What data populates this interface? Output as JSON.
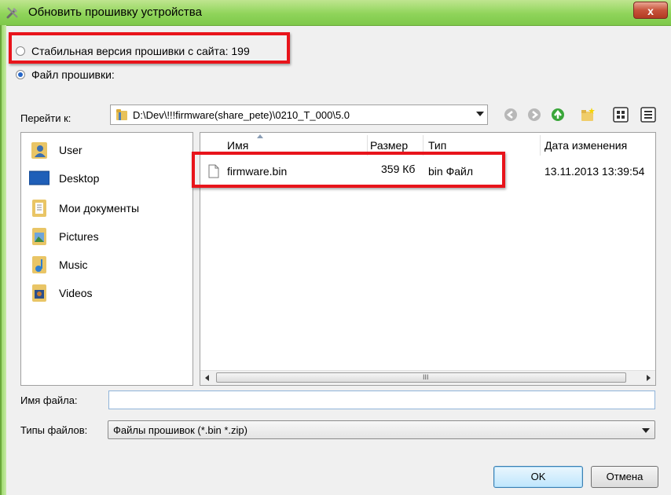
{
  "window": {
    "title": "Обновить прошивку устройства",
    "close_label": "x"
  },
  "source": {
    "stable_label": "Стабильная версия прошивки с сайта: 199",
    "file_label": "Файл прошивки:",
    "selected": "file"
  },
  "navigation": {
    "goto_label": "Перейти к:",
    "path": "D:\\Dev\\!!!firmware(share_pete)\\0210_T_000\\5.0",
    "toolbar_icons": [
      "back-icon",
      "forward-icon",
      "up-folder-icon",
      "new-folder-icon",
      "list-view-icon",
      "details-view-icon"
    ]
  },
  "places": [
    {
      "label": "User",
      "icon": "user-folder-icon"
    },
    {
      "label": "Desktop",
      "icon": "desktop-icon"
    },
    {
      "label": "Мои документы",
      "icon": "documents-icon"
    },
    {
      "label": "Pictures",
      "icon": "pictures-icon"
    },
    {
      "label": "Music",
      "icon": "music-icon"
    },
    {
      "label": "Videos",
      "icon": "videos-icon"
    }
  ],
  "file_list": {
    "columns": [
      "Имя",
      "Размер",
      "Тип",
      "Дата изменения"
    ],
    "rows": [
      {
        "name": "firmware.bin",
        "size": "359 Кб",
        "type": "bin Файл",
        "modified": "13.11.2013 13:39:54"
      }
    ],
    "scroll_grip": "III"
  },
  "filename": {
    "label": "Имя файла:",
    "value": ""
  },
  "filetype": {
    "label": "Типы файлов:",
    "selected": "Файлы прошивок (*.bin *.zip)"
  },
  "buttons": {
    "ok": "OK",
    "cancel": "Отмена"
  },
  "colors": {
    "titlebar": "#8fd45a",
    "highlight": "#e8141b",
    "close": "#c7533b"
  }
}
